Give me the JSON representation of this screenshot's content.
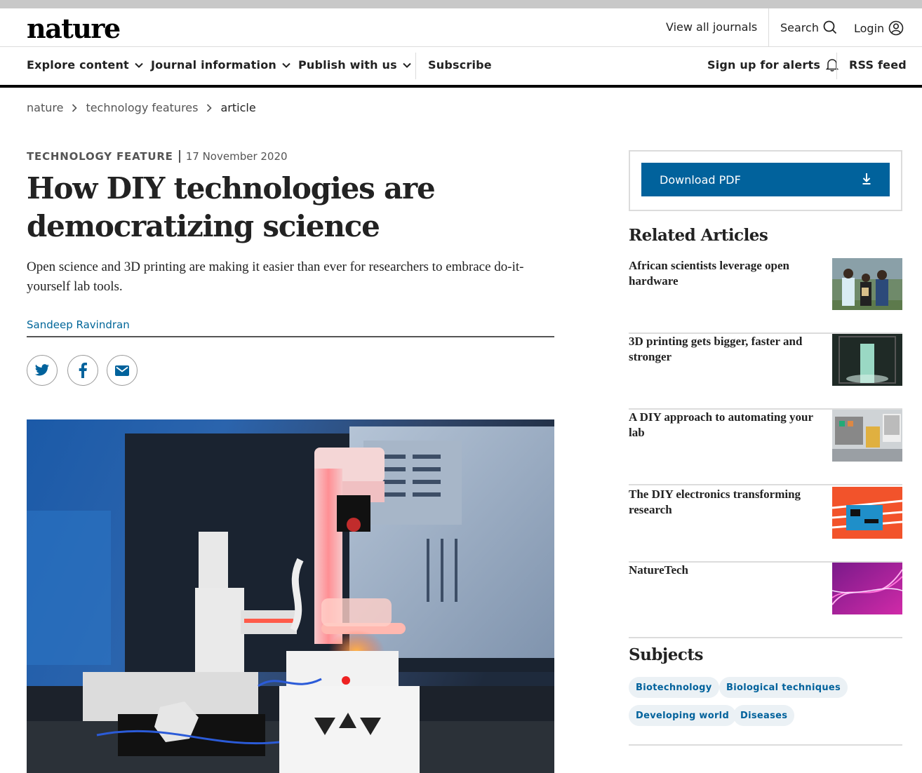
{
  "header": {
    "logo": "nature",
    "view_all_journals": "View all journals",
    "search": "Search",
    "login": "Login"
  },
  "nav": {
    "explore": "Explore content",
    "journal_info": "Journal information",
    "publish": "Publish with us",
    "subscribe": "Subscribe",
    "alerts": "Sign up for alerts",
    "rss": "RSS feed"
  },
  "breadcrumb": [
    "nature",
    "technology features",
    "article"
  ],
  "article": {
    "type": "TECHNOLOGY FEATURE",
    "date": "17 November 2020",
    "title": "How DIY technologies are democratizing science",
    "standfirst": "Open science and 3D printing are making it easier than ever for researchers to embrace do-it-yourself lab tools.",
    "author": "Sandeep Ravindran"
  },
  "sidebar": {
    "download_pdf": "Download PDF",
    "related_title": "Related Articles",
    "related": [
      {
        "title": "African scientists leverage open hardware"
      },
      {
        "title": "3D printing gets bigger, faster and stronger"
      },
      {
        "title": "A DIY approach to automating your lab"
      },
      {
        "title": "The DIY electronics transforming research"
      },
      {
        "title": "NatureTech"
      }
    ],
    "subjects_title": "Subjects",
    "subjects": [
      "Biotechnology",
      "Biological techniques",
      "Developing world",
      "Diseases"
    ]
  },
  "colors": {
    "link": "#006699",
    "button": "#01629c",
    "tag_bg": "#ebf1f5"
  }
}
